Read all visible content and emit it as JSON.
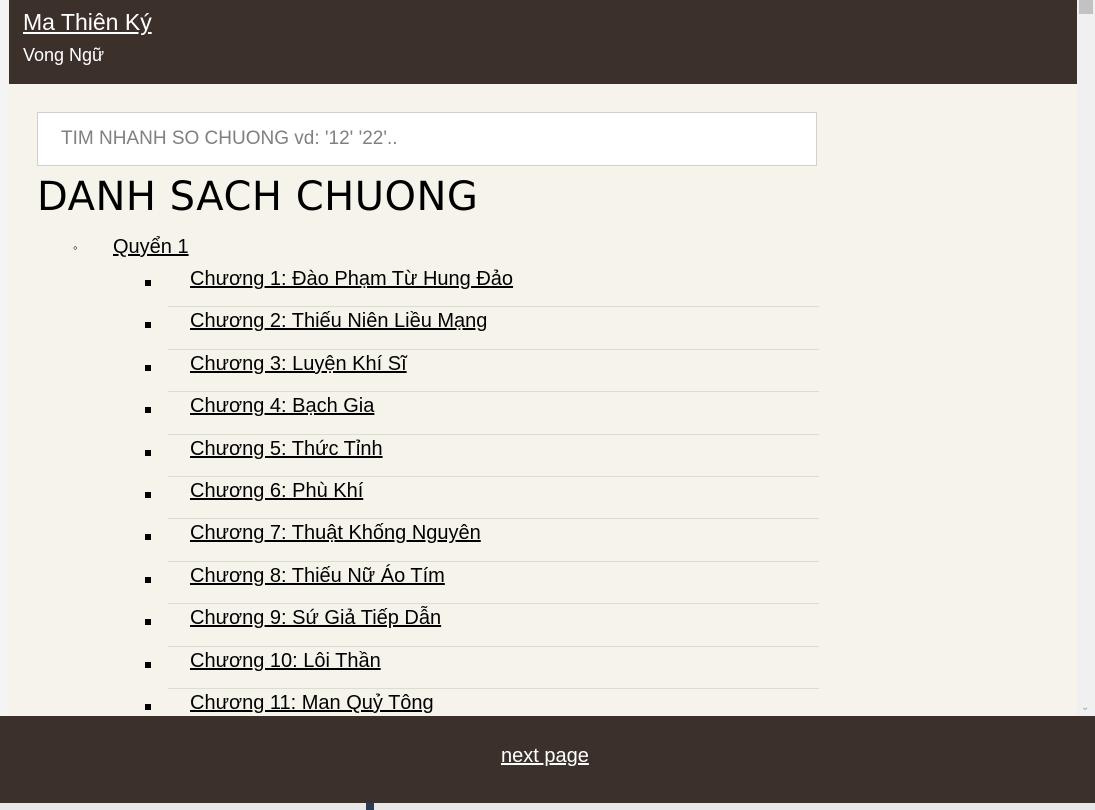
{
  "header": {
    "title": "Ma Thiên Ký",
    "author": "Vong Ngữ"
  },
  "search": {
    "placeholder": "TIM NHANH SO CHUONG vd: '12' '22'.."
  },
  "heading": "DANH SACH CHUONG",
  "volume": {
    "label": "Quyển 1"
  },
  "chapters": [
    {
      "label": "Chương 1: Đào Phạm Từ Hung Đảo"
    },
    {
      "label": "Chương 2: Thiếu Niên Liều Mạng"
    },
    {
      "label": "Chương 3: Luyện Khí Sĩ"
    },
    {
      "label": "Chương 4: Bạch Gia"
    },
    {
      "label": "Chương 5: Thức Tỉnh"
    },
    {
      "label": "Chương 6: Phù Khí"
    },
    {
      "label": "Chương 7: Thuật Khống Nguyên"
    },
    {
      "label": "Chương 8: Thiếu Nữ Áo Tím"
    },
    {
      "label": "Chương 9: Sứ Giả Tiếp Dẫn"
    },
    {
      "label": "Chương 10: Lôi Thần"
    },
    {
      "label": "Chương 11: Man Quỷ Tông"
    }
  ],
  "footer": {
    "next_label": "next page"
  },
  "colors": {
    "header_bg": "#3b302a",
    "content_bg": "#f5f3ea"
  }
}
